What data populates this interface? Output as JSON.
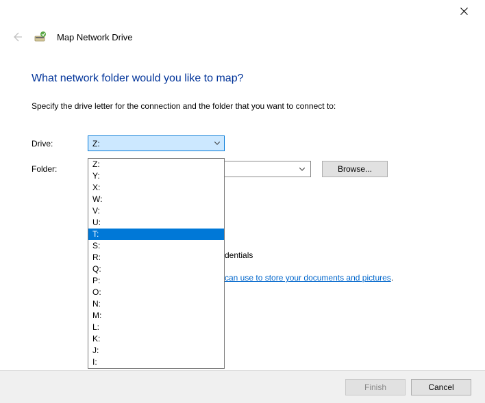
{
  "window": {
    "title": "Map Network Drive"
  },
  "content": {
    "heading": "What network folder would you like to map?",
    "subtext": "Specify the drive letter for the connection and the folder that you want to connect to:",
    "drive_label": "Drive:",
    "folder_label": "Folder:",
    "drive_selected": "Z:",
    "browse_label": "Browse...",
    "partial_credentials": "dentials",
    "link_text": "can use to store your documents and pictures",
    "link_suffix": "."
  },
  "dropdown": {
    "items": [
      "Z:",
      "Y:",
      "X:",
      "W:",
      "V:",
      "U:",
      "T:",
      "S:",
      "R:",
      "Q:",
      "P:",
      "O:",
      "N:",
      "M:",
      "L:",
      "K:",
      "J:",
      "I:"
    ],
    "highlighted_index": 6
  },
  "footer": {
    "finish_label": "Finish",
    "cancel_label": "Cancel"
  }
}
